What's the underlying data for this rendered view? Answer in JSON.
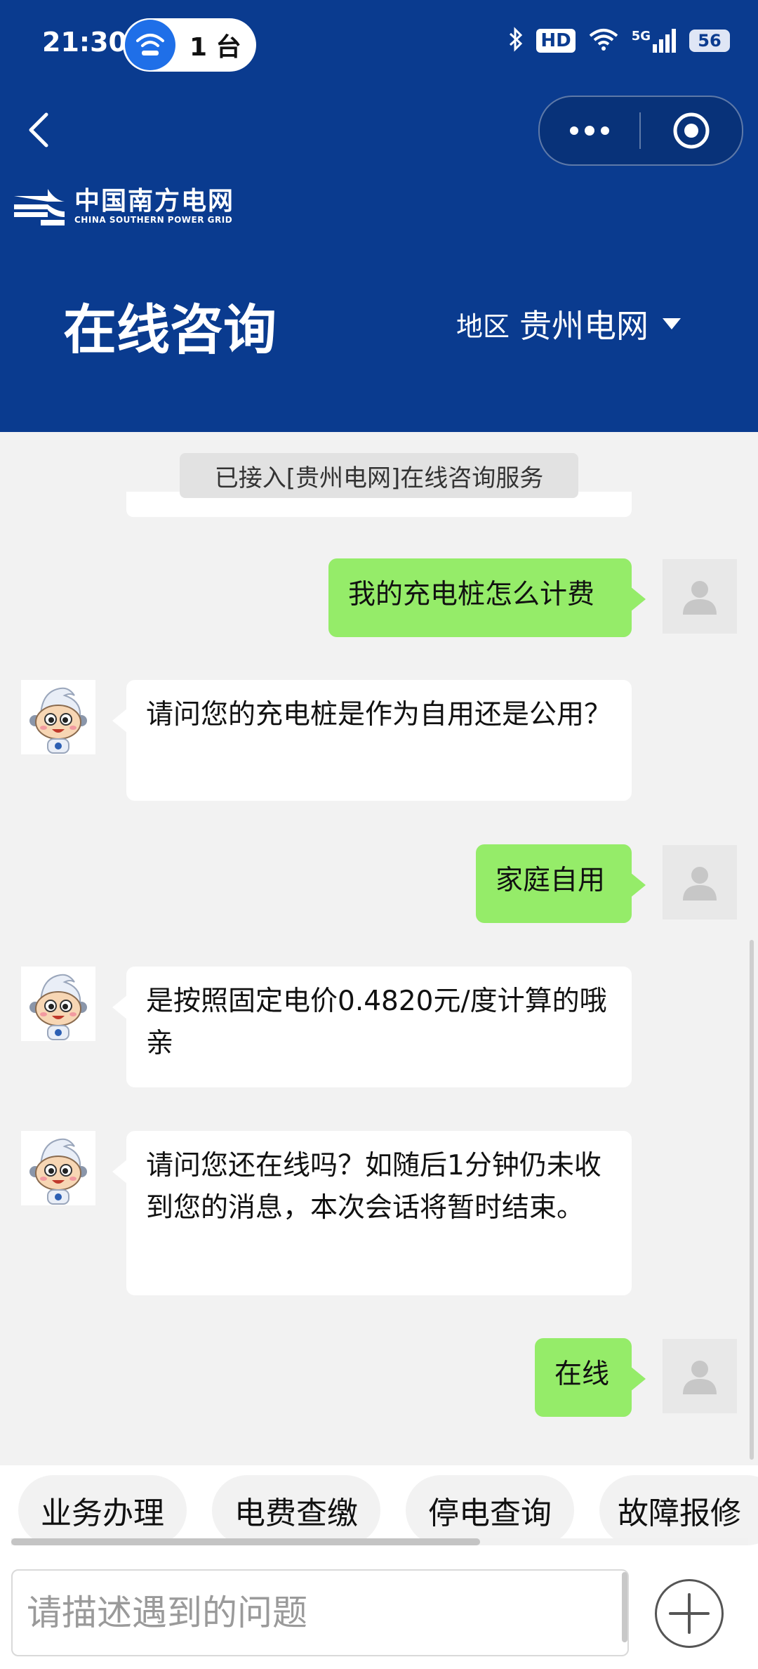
{
  "status_bar": {
    "time": "21:30",
    "hotspot_count": "1 台",
    "hd_label": "HD",
    "network_label": "5G",
    "battery": "56",
    "icons": [
      "bluetooth-icon",
      "hd-icon",
      "wifi-icon",
      "signal-5g-icon",
      "battery-icon"
    ]
  },
  "header": {
    "logo_cn": "中国南方电网",
    "logo_en": "CHINA SOUTHERN POWER GRID",
    "title": "在线咨询",
    "region_label": "地区",
    "region_value": "贵州电网"
  },
  "chat": {
    "notice": "已接入[贵州电网]在线咨询服务",
    "messages": [
      {
        "from": "user",
        "text": "我的充电桩怎么计费"
      },
      {
        "from": "bot",
        "text": "请问您的充电桩是作为自用还是公用？"
      },
      {
        "from": "user",
        "text": "家庭自用"
      },
      {
        "from": "bot",
        "text": "是按照固定电价0.4820元/度计算的哦亲"
      },
      {
        "from": "bot",
        "text": "请问您还在线吗？如随后1分钟仍未收到您的消息，本次会话将暂时结束。"
      },
      {
        "from": "user",
        "text": "在线"
      }
    ]
  },
  "quick_actions": [
    "业务办理",
    "电费查缴",
    "停电查询",
    "故障报修"
  ],
  "input": {
    "placeholder": "请描述遇到的问题",
    "value": ""
  },
  "colors": {
    "header_bg": "#0a3b8f",
    "user_bubble": "#95ec69",
    "bot_bubble": "#ffffff",
    "chat_bg": "#f2f2f2"
  }
}
